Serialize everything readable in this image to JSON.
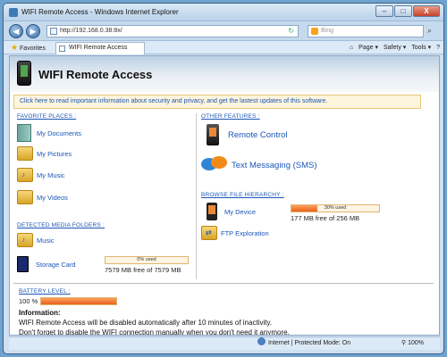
{
  "window": {
    "title": "WIFI Remote Access - Windows Internet Explorer",
    "min": "–",
    "max": "□",
    "close": "X"
  },
  "browser": {
    "back": "◀",
    "forward": "▶",
    "url": "http://192.168.0.38:8x/",
    "search_placeholder": "Bing",
    "search_go": "⌕",
    "favorites_label": "Favorites",
    "tab_title": "WIFI Remote Access",
    "commands": [
      "Page ▾",
      "Safety ▾",
      "Tools ▾",
      "?"
    ]
  },
  "app": {
    "title": "WIFI Remote Access",
    "banner": "Click here to read important information about security and privacy, and get the lastest updates of this software."
  },
  "favorites": {
    "heading": "Favorite Places :",
    "items": [
      "My Documents",
      "My Pictures",
      "My Music",
      "My Videos"
    ]
  },
  "media": {
    "heading": "Detected Media Folders :",
    "music": "Music",
    "storage_card": "Storage Card",
    "storage_used_label": "0% used",
    "storage_used_fraction": 0.0,
    "storage_free": "7579 MB free of 7579 MB"
  },
  "features": {
    "heading": "Other Features :",
    "remote_control": "Remote Control",
    "sms": "Text Messaging (SMS)"
  },
  "browse": {
    "heading": "Browse file hierarchy :",
    "my_device": "My Device",
    "device_used_label": "30% used",
    "device_used_fraction": 0.3,
    "device_free": "177 MB free of 256 MB",
    "ftp": "FTP Exploration"
  },
  "battery": {
    "heading": "Battery Level :",
    "percent_label": "100 %",
    "level_fraction": 1.0
  },
  "info": {
    "heading": "Information:",
    "line1": "WIFI Remote Access will be disabled automatically after 10 minutes of inactivity.",
    "line2": "Don't forget to disable the WIFI connection manually when you don't need it anymore."
  },
  "status": {
    "zone": "Internet | Protected Mode: On",
    "zoom": "100%"
  }
}
